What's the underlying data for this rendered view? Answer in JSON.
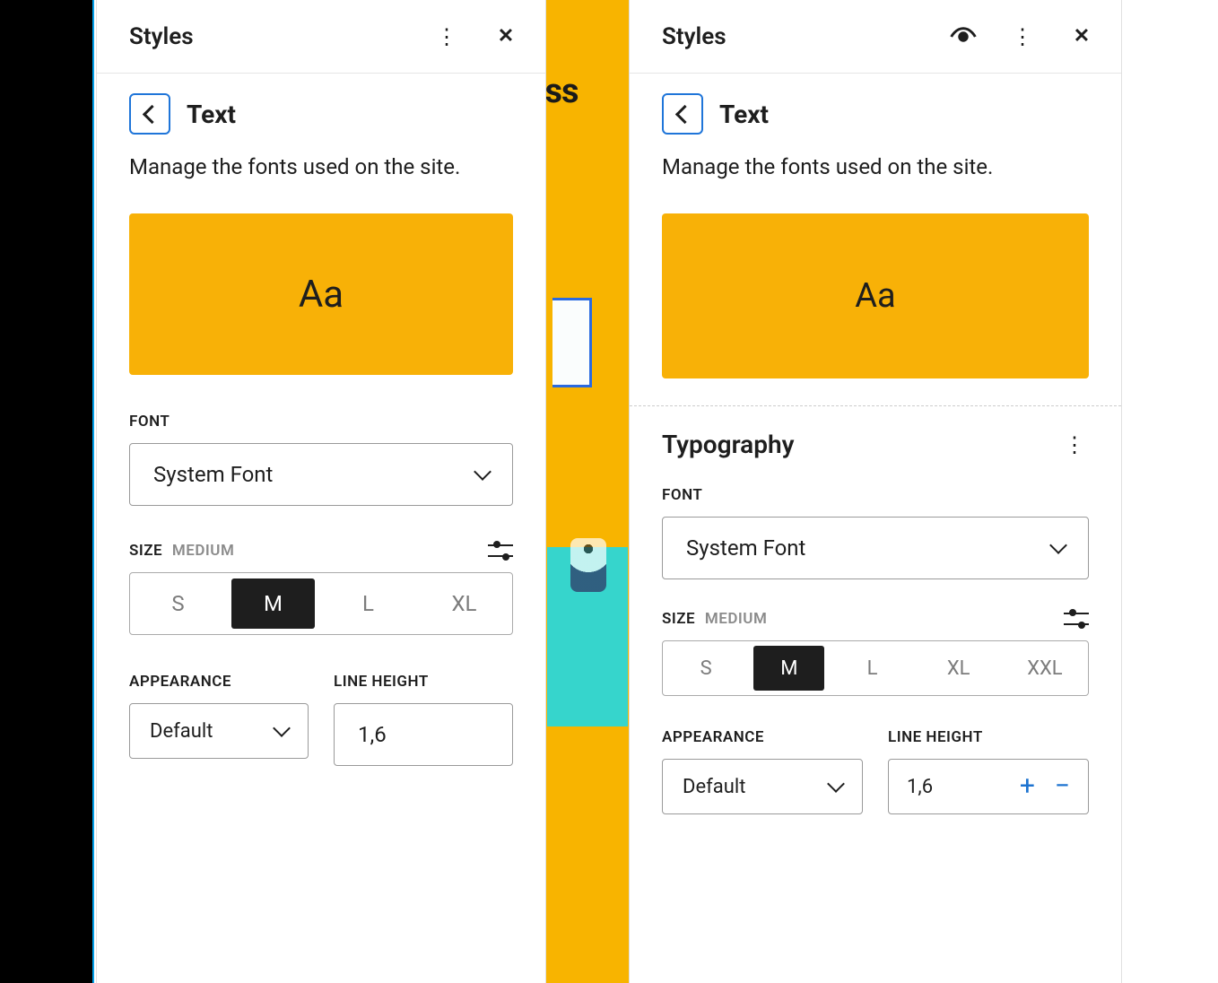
{
  "left": {
    "header_title": "Styles",
    "crumb": "Text",
    "desc": "Manage the fonts used on the site.",
    "preview": "Aa",
    "font_label": "Font",
    "font_value": "System Font",
    "size_label": "Size",
    "size_sub": "Medium",
    "sizes": [
      "S",
      "M",
      "L",
      "XL"
    ],
    "size_active": "M",
    "appearance_label": "Appearance",
    "appearance_value": "Default",
    "lineheight_label": "Line Height",
    "lineheight_value": "1,6"
  },
  "right": {
    "header_title": "Styles",
    "crumb": "Text",
    "desc": "Manage the fonts used on the site.",
    "preview": "Aa",
    "section_title": "Typography",
    "font_label": "Font",
    "font_value": "System Font",
    "size_label": "Size",
    "size_sub": "Medium",
    "sizes": [
      "S",
      "M",
      "L",
      "XL",
      "XXL"
    ],
    "size_active": "M",
    "appearance_label": "Appearance",
    "appearance_value": "Default",
    "lineheight_label": "Line Height",
    "lineheight_value": "1,6",
    "plus": "+",
    "minus": "−"
  }
}
